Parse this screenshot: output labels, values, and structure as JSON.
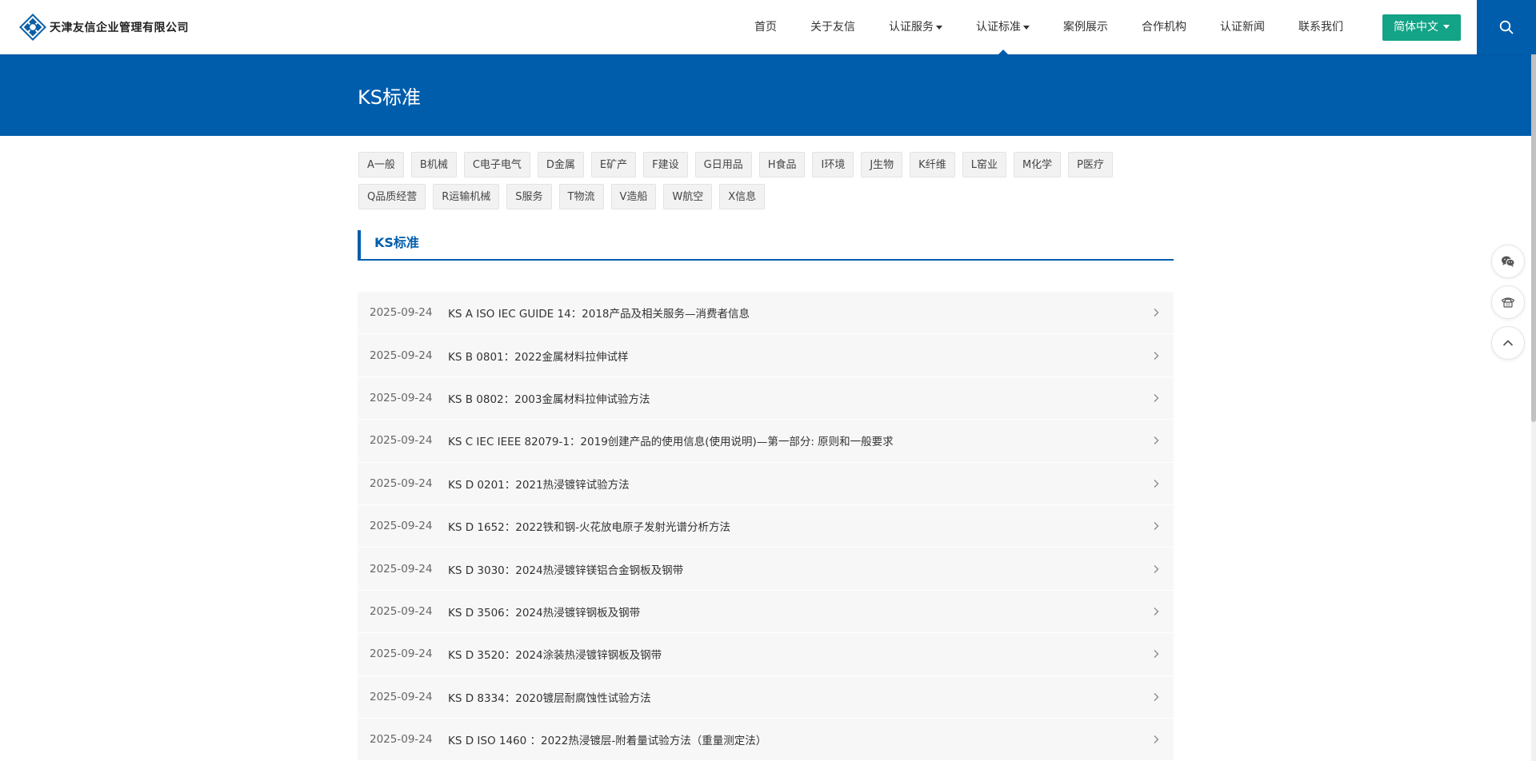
{
  "site": {
    "company_name": "天津友信企业管理有限公司"
  },
  "nav": {
    "items": [
      {
        "label": "首页",
        "dropdown": false,
        "active": false
      },
      {
        "label": "关于友信",
        "dropdown": false,
        "active": false
      },
      {
        "label": "认证服务",
        "dropdown": true,
        "active": false
      },
      {
        "label": "认证标准",
        "dropdown": true,
        "active": true
      },
      {
        "label": "案例展示",
        "dropdown": false,
        "active": false
      },
      {
        "label": "合作机构",
        "dropdown": false,
        "active": false
      },
      {
        "label": "认证新闻",
        "dropdown": false,
        "active": false
      },
      {
        "label": "联系我们",
        "dropdown": false,
        "active": false
      }
    ],
    "lang_label": "简体中文",
    "search_icon": "search-icon"
  },
  "banner": {
    "title": "KS标准"
  },
  "categories": [
    "A一般",
    "B机械",
    "C电子电气",
    "D金属",
    "E矿产",
    "F建设",
    "G日用品",
    "H食品",
    "I环境",
    "J生物",
    "K纤维",
    "L窑业",
    "M化学",
    "P医疗",
    "Q品质经营",
    "R运输机械",
    "S服务",
    "T物流",
    "V造船",
    "W航空",
    "X信息"
  ],
  "section": {
    "title": "KS标准"
  },
  "list": [
    {
      "date": "2025-09-24",
      "title": "KS A ISO IEC GUIDE 14：2018产品及相关服务—消费者信息"
    },
    {
      "date": "2025-09-24",
      "title": "KS B 0801：2022金属材料拉伸试样"
    },
    {
      "date": "2025-09-24",
      "title": "KS B 0802：2003金属材料拉伸试验方法"
    },
    {
      "date": "2025-09-24",
      "title": "KS C IEC IEEE 82079-1：2019创建产品的使用信息(使用说明)—第一部分: 原则和一般要求"
    },
    {
      "date": "2025-09-24",
      "title": "KS D 0201：2021热浸镀锌试验方法"
    },
    {
      "date": "2025-09-24",
      "title": "KS D 1652：2022铁和钢-火花放电原子发射光谱分析方法"
    },
    {
      "date": "2025-09-24",
      "title": "KS D 3030：2024热浸镀锌镁铝合金钢板及钢带"
    },
    {
      "date": "2025-09-24",
      "title": "KS D 3506：2024热浸镀锌钢板及钢带"
    },
    {
      "date": "2025-09-24",
      "title": "KS D 3520：2024涂装热浸镀锌钢板及钢带"
    },
    {
      "date": "2025-09-24",
      "title": "KS D 8334：2020镀层耐腐蚀性试验方法"
    },
    {
      "date": "2025-09-24",
      "title": "KS D ISO 1460 ：2022热浸镀层-附着量试验方法（重量测定法）"
    }
  ],
  "float_tools": [
    "wechat-icon",
    "phone-icon",
    "back-to-top-icon"
  ],
  "colors": {
    "primary": "#005dac",
    "accent": "#13a386"
  }
}
